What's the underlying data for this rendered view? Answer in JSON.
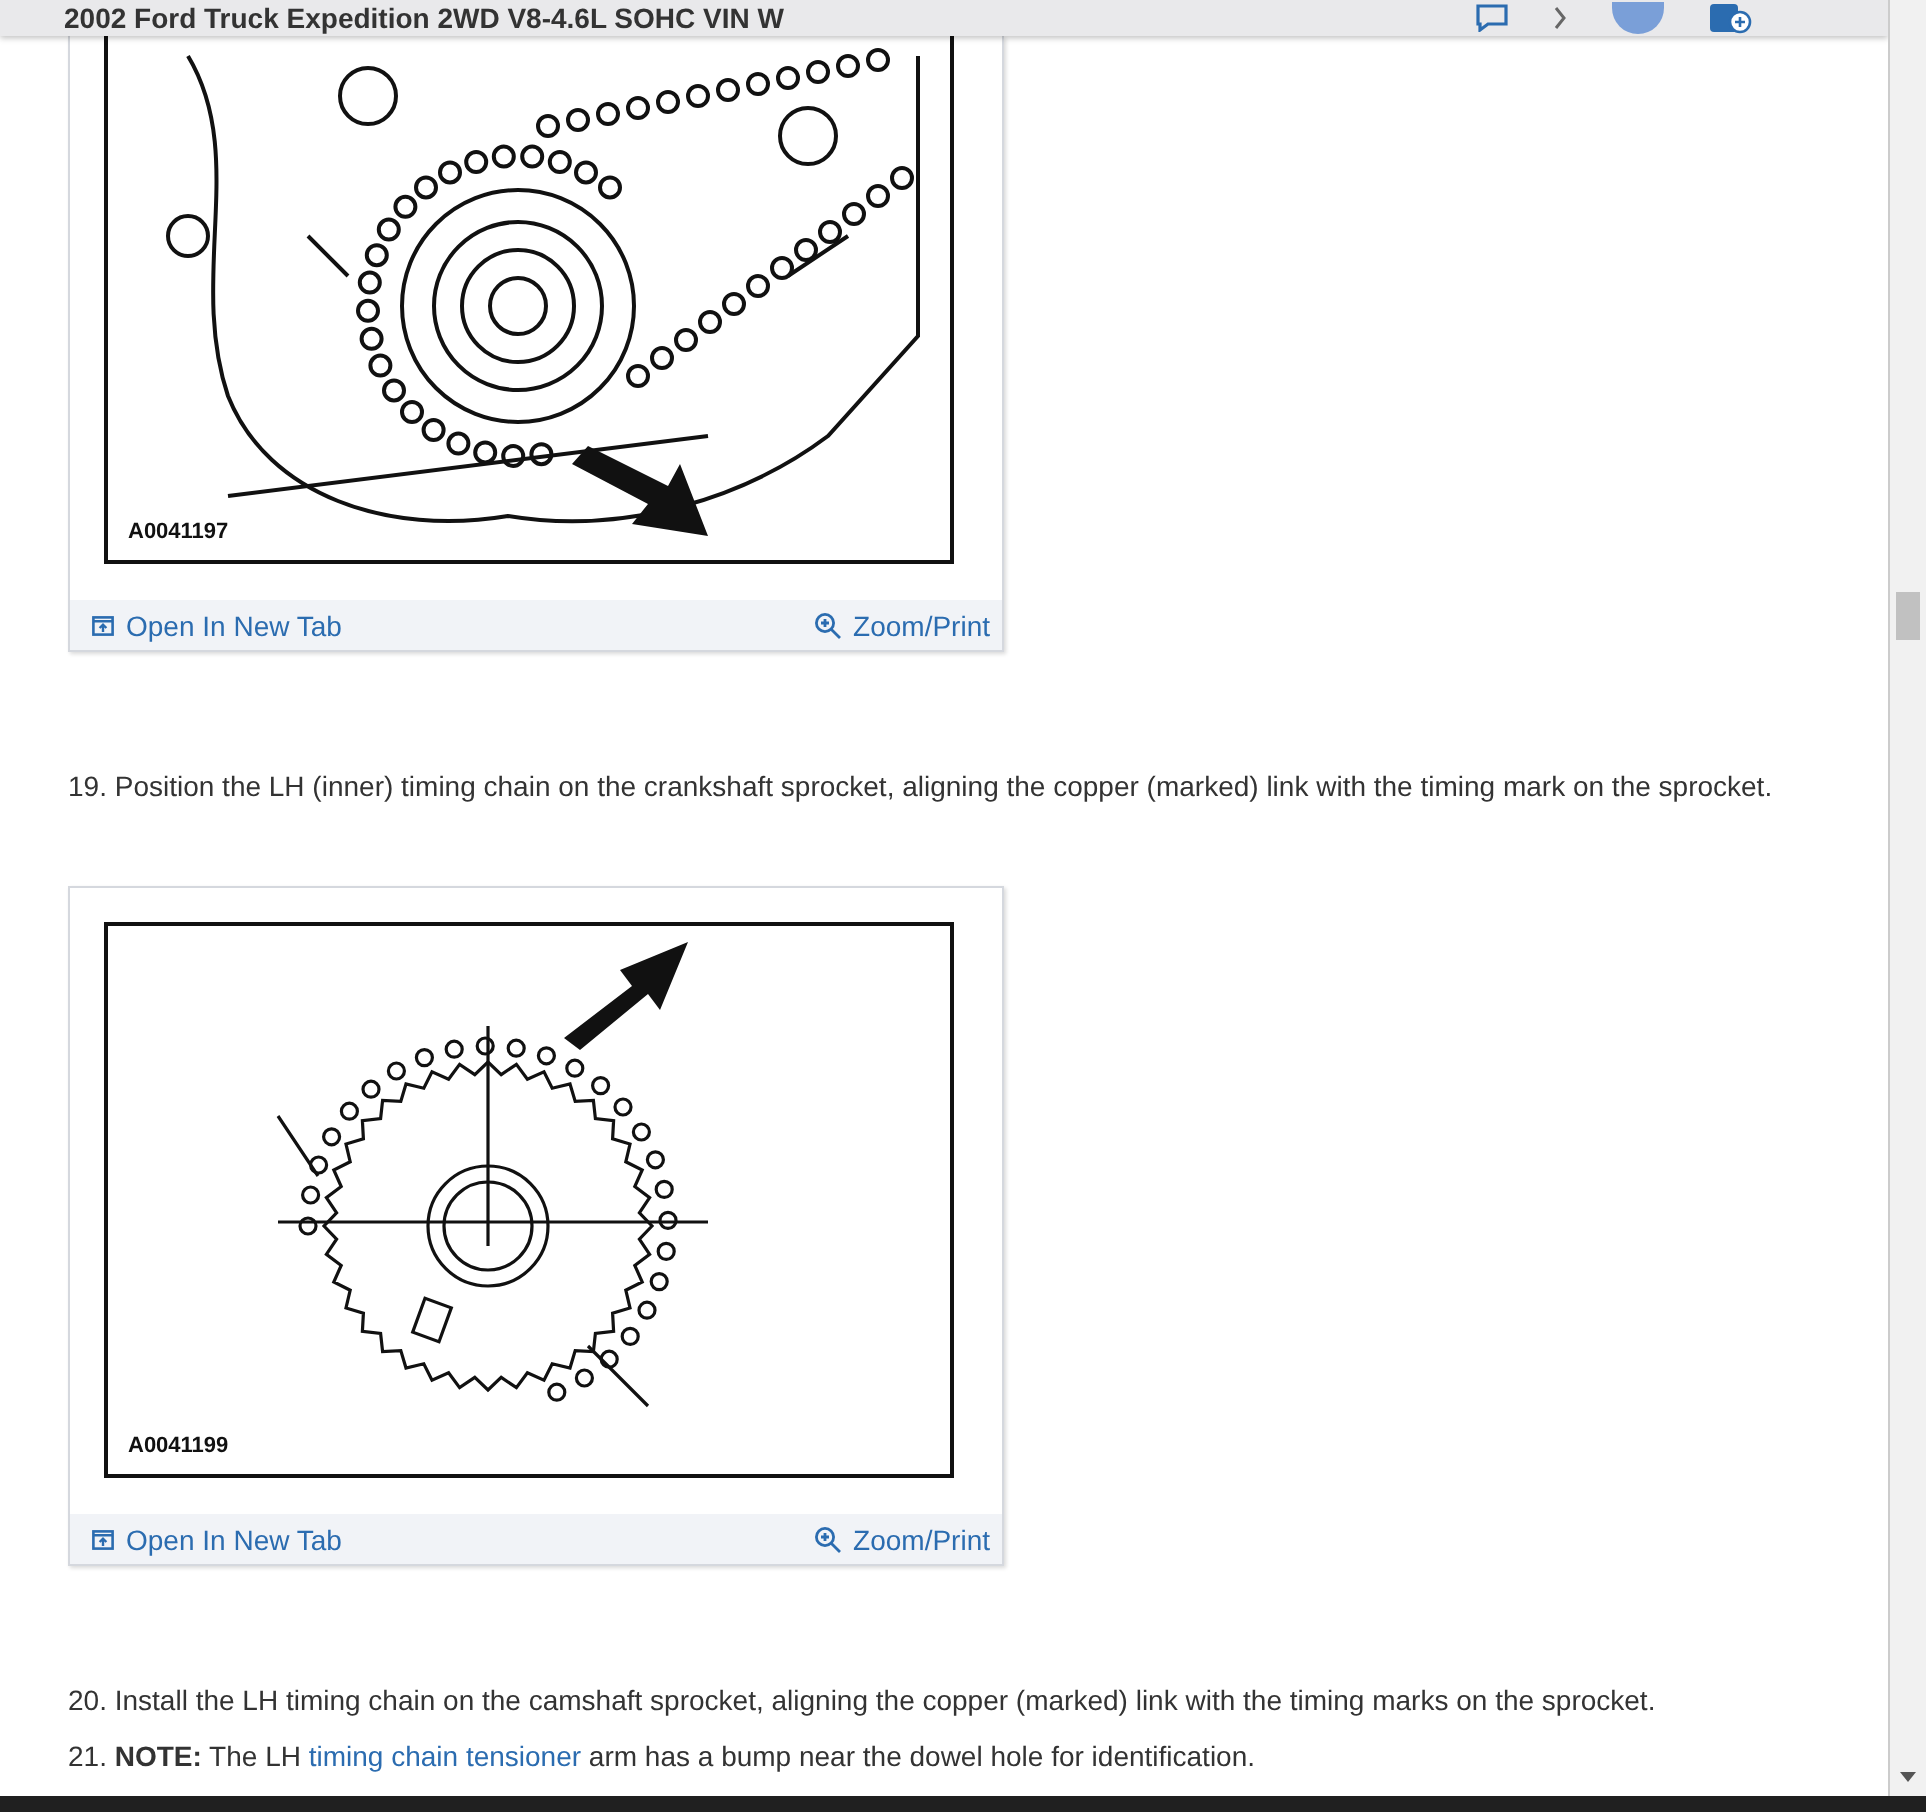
{
  "header": {
    "title": "2002 Ford Truck Expedition 2WD V8-4.6L SOHC VIN W"
  },
  "content": [
    {
      "kind": "engine",
      "code": "A0041197",
      "open_link": "Open In New Tab",
      "zoom_link": "Zoom/Print"
    },
    {
      "kind": "step",
      "text": "19. Position the LH (inner) timing chain on the crankshaft sprocket, aligning the copper (marked) link with the timing mark on the sprocket."
    },
    {
      "kind": "sprocket",
      "code": "A0041199",
      "open_link": "Open In New Tab",
      "zoom_link": "Zoom/Print"
    },
    {
      "kind": "step",
      "text": "20. Install the LH timing chain on the camshaft sprocket, aligning the copper (marked) link with the timing marks on the sprocket."
    },
    {
      "kind": "step",
      "text": "21. **NOTE:** The LH ",
      "link": "timing chain tensioner",
      "text_after": " arm has a bump near the dowel hole for identification."
    }
  ]
}
